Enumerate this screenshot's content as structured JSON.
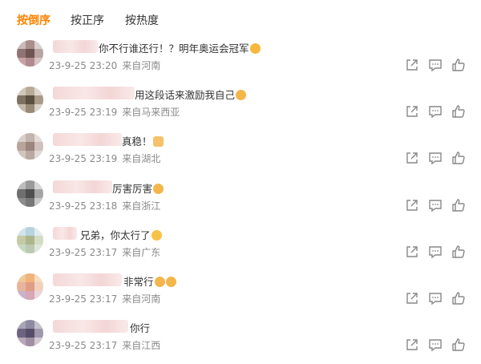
{
  "tabs": [
    {
      "label": "按倒序",
      "active": true
    },
    {
      "label": "按正序",
      "active": false
    },
    {
      "label": "按热度",
      "active": false
    }
  ],
  "accent_color": "#ff8200",
  "comments": [
    {
      "text": "你不行谁还行！？明年奥运会冠军",
      "emoji": "surprised-emoji",
      "time": "23-9-25 23:20",
      "location": "来自河南"
    },
    {
      "text": "用这段话来激励我自己",
      "emoji": "scream-emoji",
      "time": "23-9-25 23:19",
      "location": "来自马来西亚"
    },
    {
      "text": "真稳！",
      "emoji": "thumbs-up-emoji",
      "time": "23-9-25 23:19",
      "location": "来自湖北"
    },
    {
      "text": "厉害厉害",
      "emoji": "scream-emoji",
      "time": "23-9-25 23:18",
      "location": "来自浙江"
    },
    {
      "text": "兄弟，你太行了",
      "emoji": "clap-emoji",
      "time": "23-9-25 23:17",
      "location": "来自广东"
    },
    {
      "text": "非常行",
      "emoji": "scream-emoji",
      "time": "23-9-25 23:17",
      "location": "来自河南"
    },
    {
      "text": "你行",
      "emoji": "",
      "time": "23-9-25 23:17",
      "location": "来自江西"
    }
  ]
}
